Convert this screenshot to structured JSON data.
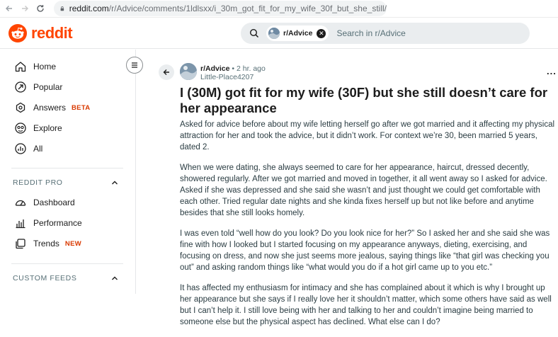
{
  "browser": {
    "url_host": "reddit.com",
    "url_path": "/r/Advice/comments/1ldlsxx/i_30m_got_fit_for_my_wife_30f_but_she_still/"
  },
  "header": {
    "logo_text": "reddit",
    "search_chip": "r/Advice",
    "search_placeholder": "Search in r/Advice"
  },
  "sidebar": {
    "items": [
      {
        "label": "Home",
        "icon": "home-icon"
      },
      {
        "label": "Popular",
        "icon": "popular-icon"
      },
      {
        "label": "Answers",
        "icon": "answers-icon",
        "badge": "BETA"
      },
      {
        "label": "Explore",
        "icon": "explore-icon"
      },
      {
        "label": "All",
        "icon": "all-icon"
      }
    ],
    "reddit_pro": {
      "title": "REDDIT PRO",
      "items": [
        {
          "label": "Dashboard",
          "icon": "dashboard-icon"
        },
        {
          "label": "Performance",
          "icon": "performance-icon"
        },
        {
          "label": "Trends",
          "icon": "trends-icon",
          "badge": "NEW"
        }
      ]
    },
    "custom_feeds_title": "CUSTOM FEEDS"
  },
  "post": {
    "subreddit": "r/Advice",
    "separator": "•",
    "time": "2 hr. ago",
    "author": "Little-Place4207",
    "more": "...",
    "title": "I (30M) got fit for my wife (30F) but she still doesn’t care for her appearance",
    "paragraphs": [
      "Asked for advice before about my wife letting herself go after we got married and it affecting my physical attraction for her and took the advice, but it didn’t work. For context we’re 30, been married 5 years, dated 2.",
      "When we were dating, she always seemed to care for her appearance, haircut, dressed decently, showered regularly. After we got married and moved in together, it all went away so I asked for advice. Asked if she was depressed and she said she wasn’t and just thought we could get comfortable with each other. Tried regular date nights and she kinda fixes herself up but not like before and anytime besides that she still looks homely.",
      "I was even told “well how do you look? Do you look nice for her?” So I asked her and she said she was fine with how I looked but I started focusing on my appearance anyways, dieting, exercising, and focusing on dress, and now she just seems more jealous, saying things like “that girl was checking you out” and asking random things like “what would you do if a hot girl came up to you etc.”",
      "It has affected my enthusiasm for intimacy and she has complained about it which is why I brought up her appearance but she says if I really love her it shouldn’t matter, which some others have said as well but I can’t help it. I still love being with her and talking to her and couldn’t imagine being married to someone else but the physical aspect has declined. What else can I do?"
    ]
  },
  "colors": {
    "brand": "#ff4500",
    "badge": "#d93900",
    "muted_text": "#576f76",
    "search_bg": "#eaedef"
  }
}
